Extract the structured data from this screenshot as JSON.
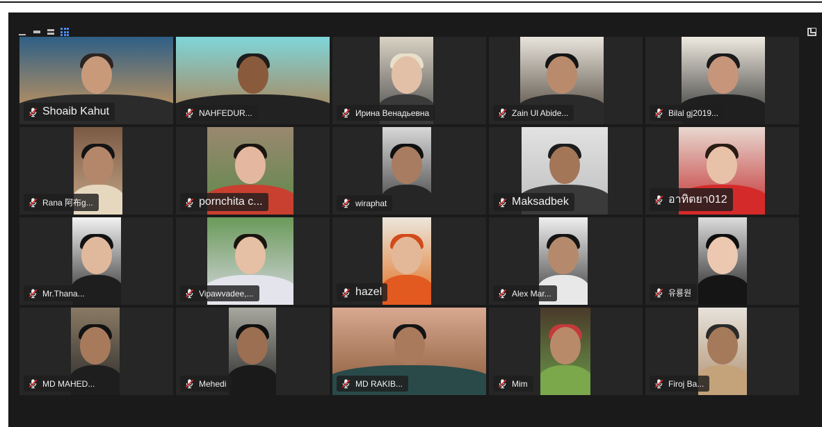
{
  "toolbar": {
    "view_icons": [
      "minimize-view-icon",
      "filmstrip-view-icon",
      "speaker-view-icon",
      "gallery-view-icon"
    ],
    "exit_icon": "exit-fullscreen-icon"
  },
  "colors": {
    "background": "#1a1a1a",
    "tile": "#262626",
    "accent": "#4b8ef5",
    "muted_mic": "#e02828"
  },
  "participants": [
    {
      "name": "Shoaib Kahut",
      "muted": true
    },
    {
      "name": "NAHFEDUR...",
      "muted": true
    },
    {
      "name": "Ирина Венадьевна",
      "muted": true
    },
    {
      "name": "Zain Ul Abide...",
      "muted": true
    },
    {
      "name": "Bilal gj2019...",
      "muted": true
    },
    {
      "name": "Rana 阿布g...",
      "muted": true
    },
    {
      "name": "pornchita c...",
      "muted": true
    },
    {
      "name": "wiraphat",
      "muted": true
    },
    {
      "name": "Maksadbek",
      "muted": true
    },
    {
      "name": "อาทิตยา012",
      "muted": true
    },
    {
      "name": "Mr.Thana...",
      "muted": true
    },
    {
      "name": "Vipawvadee,...",
      "muted": true
    },
    {
      "name": "hazel",
      "muted": true
    },
    {
      "name": "Alex Mar...",
      "muted": true
    },
    {
      "name": "유룡원",
      "muted": true
    },
    {
      "name": "MD MAHED...",
      "muted": true
    },
    {
      "name": "Mehedi",
      "muted": true
    },
    {
      "name": "MD RAKIB...",
      "muted": true
    },
    {
      "name": "Mim",
      "muted": true
    },
    {
      "name": "Firoj Ba...",
      "muted": true
    }
  ]
}
